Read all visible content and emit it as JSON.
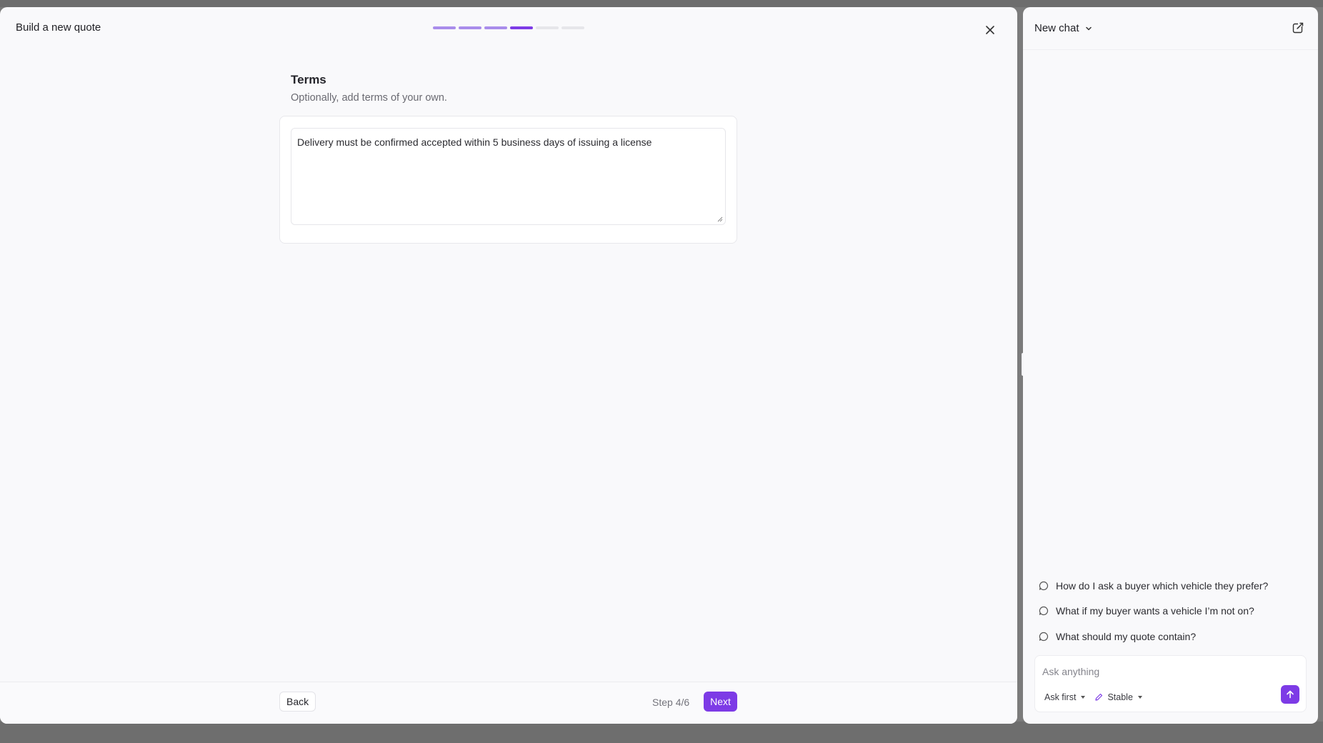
{
  "quote": {
    "title": "Build a new quote",
    "progress": {
      "total": 6,
      "current": 4
    },
    "section_title": "Terms",
    "section_subtitle": "Optionally, add terms of your own.",
    "terms_value": "Delivery must be confirmed accepted within 5 business days of issuing a license",
    "footer": {
      "back_label": "Back",
      "step_label": "Step 4/6",
      "next_label": "Next"
    }
  },
  "chat": {
    "title": "New chat",
    "suggestions": [
      "How do I ask a buyer which vehicle they prefer?",
      "What if my buyer wants a vehicle I’m not on?",
      "What should my quote contain?"
    ],
    "input_placeholder": "Ask anything",
    "mode_label": "Ask first",
    "model_label": "Stable"
  },
  "colors": {
    "accent": "#7d3be6",
    "progress_done": "#a98ceb",
    "progress_todo": "#e6e6ea"
  },
  "icons": {
    "close": "close-icon",
    "chevron": "chevron-down-icon",
    "new_chat": "new-chat-icon",
    "suggestion": "chat-bubble-icon",
    "send": "arrow-up-icon",
    "model": "pencil-icon"
  }
}
